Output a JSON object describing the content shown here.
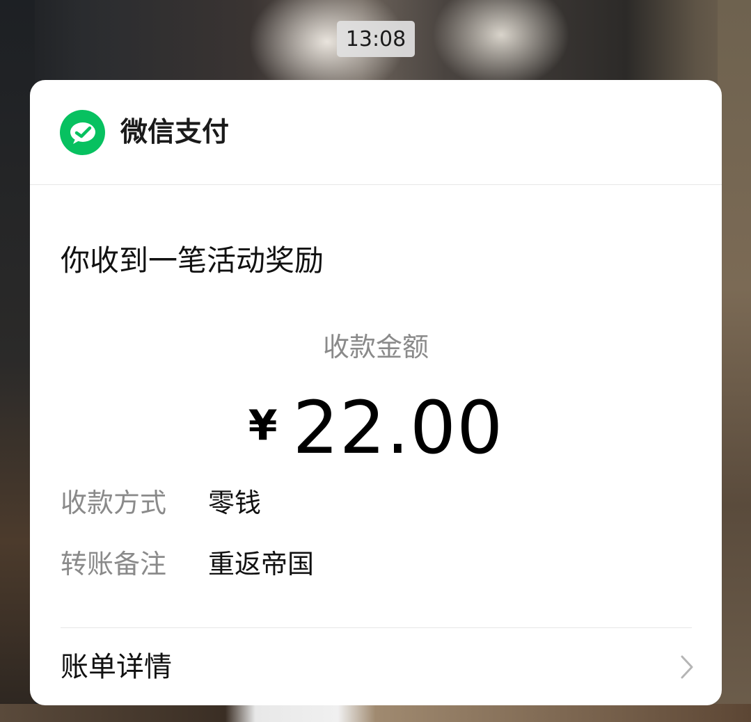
{
  "chat": {
    "timestamp": "13:08"
  },
  "card": {
    "brand": {
      "name": "微信支付",
      "icon": "wechat-pay-icon",
      "color": "#07c160"
    },
    "headline": "你收到一笔活动奖励",
    "amount": {
      "label": "收款金额",
      "currency_symbol": "¥",
      "value": "22.00"
    },
    "details": [
      {
        "key": "收款方式",
        "value": "零钱"
      },
      {
        "key": "转账备注",
        "value": "重返帝国"
      }
    ],
    "bill_link": {
      "label": "账单详情",
      "icon": "chevron-right-icon"
    }
  }
}
